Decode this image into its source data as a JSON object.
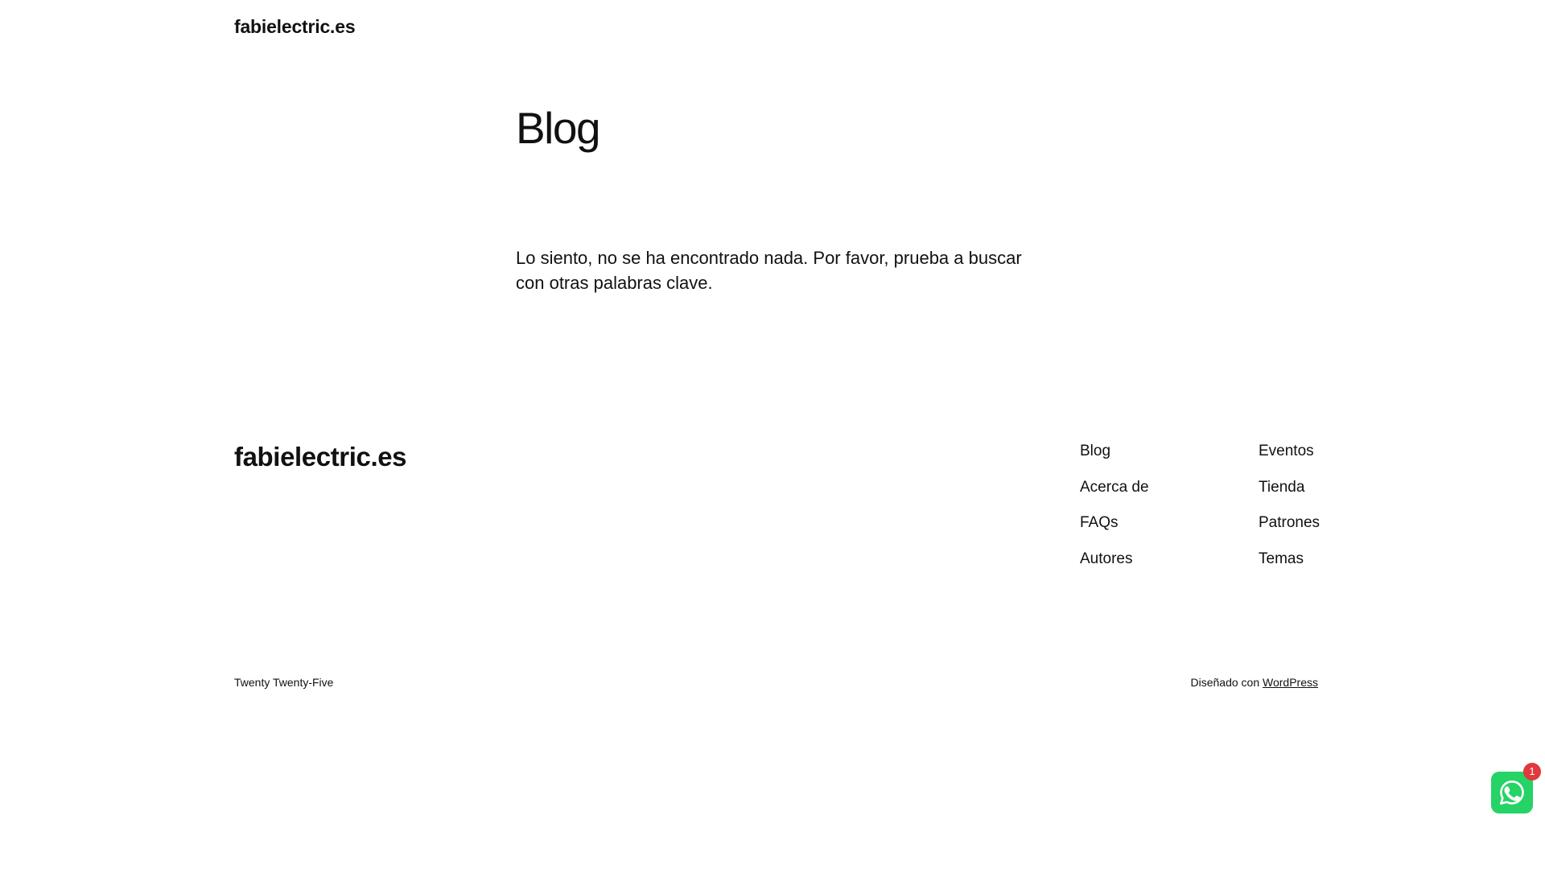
{
  "header": {
    "site_title": "fabielectric.es"
  },
  "main": {
    "title": "Blog",
    "no_results": "Lo siento, no se ha encontrado nada. Por favor, prueba a buscar con otras palabras clave."
  },
  "footer": {
    "site_title": "fabielectric.es",
    "nav_col1": [
      "Blog",
      "Acerca de",
      "FAQs",
      "Autores"
    ],
    "nav_col2": [
      "Eventos",
      "Tienda",
      "Patrones",
      "Temas"
    ],
    "theme_credit": "Twenty Twenty-Five",
    "designed_with": "Diseñado con",
    "wordpress_link": "WordPress"
  },
  "whatsapp": {
    "icon": "whatsapp-icon",
    "badge_count": "1",
    "color": "#25D366",
    "badge_color": "#e0393e"
  }
}
